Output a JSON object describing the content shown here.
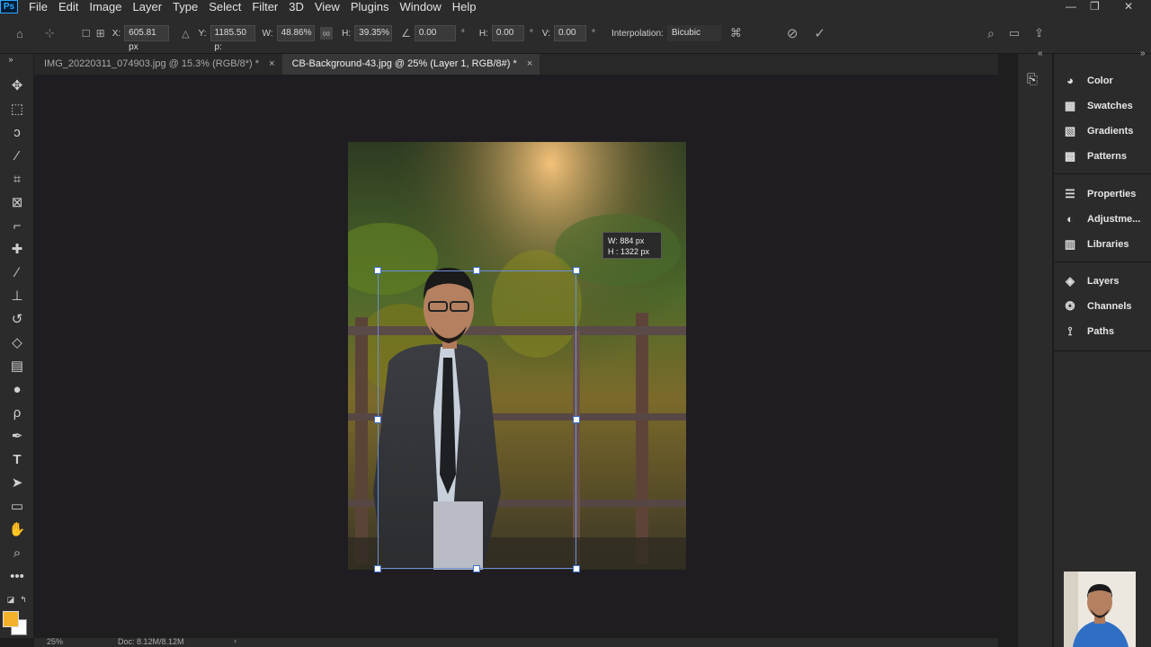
{
  "menu": {
    "app_logo": "Ps",
    "items": [
      "File",
      "Edit",
      "Image",
      "Layer",
      "Type",
      "Select",
      "Filter",
      "3D",
      "View",
      "Plugins",
      "Window",
      "Help"
    ]
  },
  "window_controls": {
    "minimize": "—",
    "restore": "❐",
    "close": "✕"
  },
  "options": {
    "x_label": "X:",
    "x_value": "605.81 px",
    "y_label": "Y:",
    "y_value": "1185.50 p:",
    "w_label": "W:",
    "w_value": "48.86%",
    "h_label": "H:",
    "h_value": "39.35%",
    "angle_value": "0.00",
    "angle_unit": "°",
    "hskew_label": "H:",
    "hskew_value": "0.00",
    "hskew_unit": "°",
    "vskew_label": "V:",
    "vskew_value": "0.00",
    "vskew_unit": "°",
    "interp_label": "Interpolation:",
    "interp_value": "Bicubic"
  },
  "tabs": [
    {
      "label": "IMG_20220311_074903.jpg @ 15.3% (RGB/8*) *",
      "close": "×"
    },
    {
      "label": "CB-Background-43.jpg @ 25% (Layer 1, RGB/8#) *",
      "close": "×"
    }
  ],
  "transform_tooltip": {
    "w": "W:   884 px",
    "h": "H :  1322 px"
  },
  "panels": [
    {
      "label": "Color",
      "icon": "color-palette-icon"
    },
    {
      "label": "Swatches",
      "icon": "swatches-grid-icon"
    },
    {
      "label": "Gradients",
      "icon": "gradient-icon"
    },
    {
      "label": "Patterns",
      "icon": "patterns-icon"
    },
    {
      "label": "Properties",
      "icon": "properties-sliders-icon"
    },
    {
      "label": "Adjustme...",
      "icon": "adjustments-icon"
    },
    {
      "label": "Libraries",
      "icon": "libraries-icon"
    },
    {
      "label": "Layers",
      "icon": "layers-icon"
    },
    {
      "label": "Channels",
      "icon": "channels-icon"
    },
    {
      "label": "Paths",
      "icon": "paths-icon"
    }
  ],
  "status": {
    "zoom": "25%",
    "doc": "Doc: 8.12M/8.12M",
    "arrow": "›"
  },
  "colors": {
    "foreground": "#f4b22a",
    "background": "#ffffff",
    "handle_border": "#3a6ec6"
  }
}
